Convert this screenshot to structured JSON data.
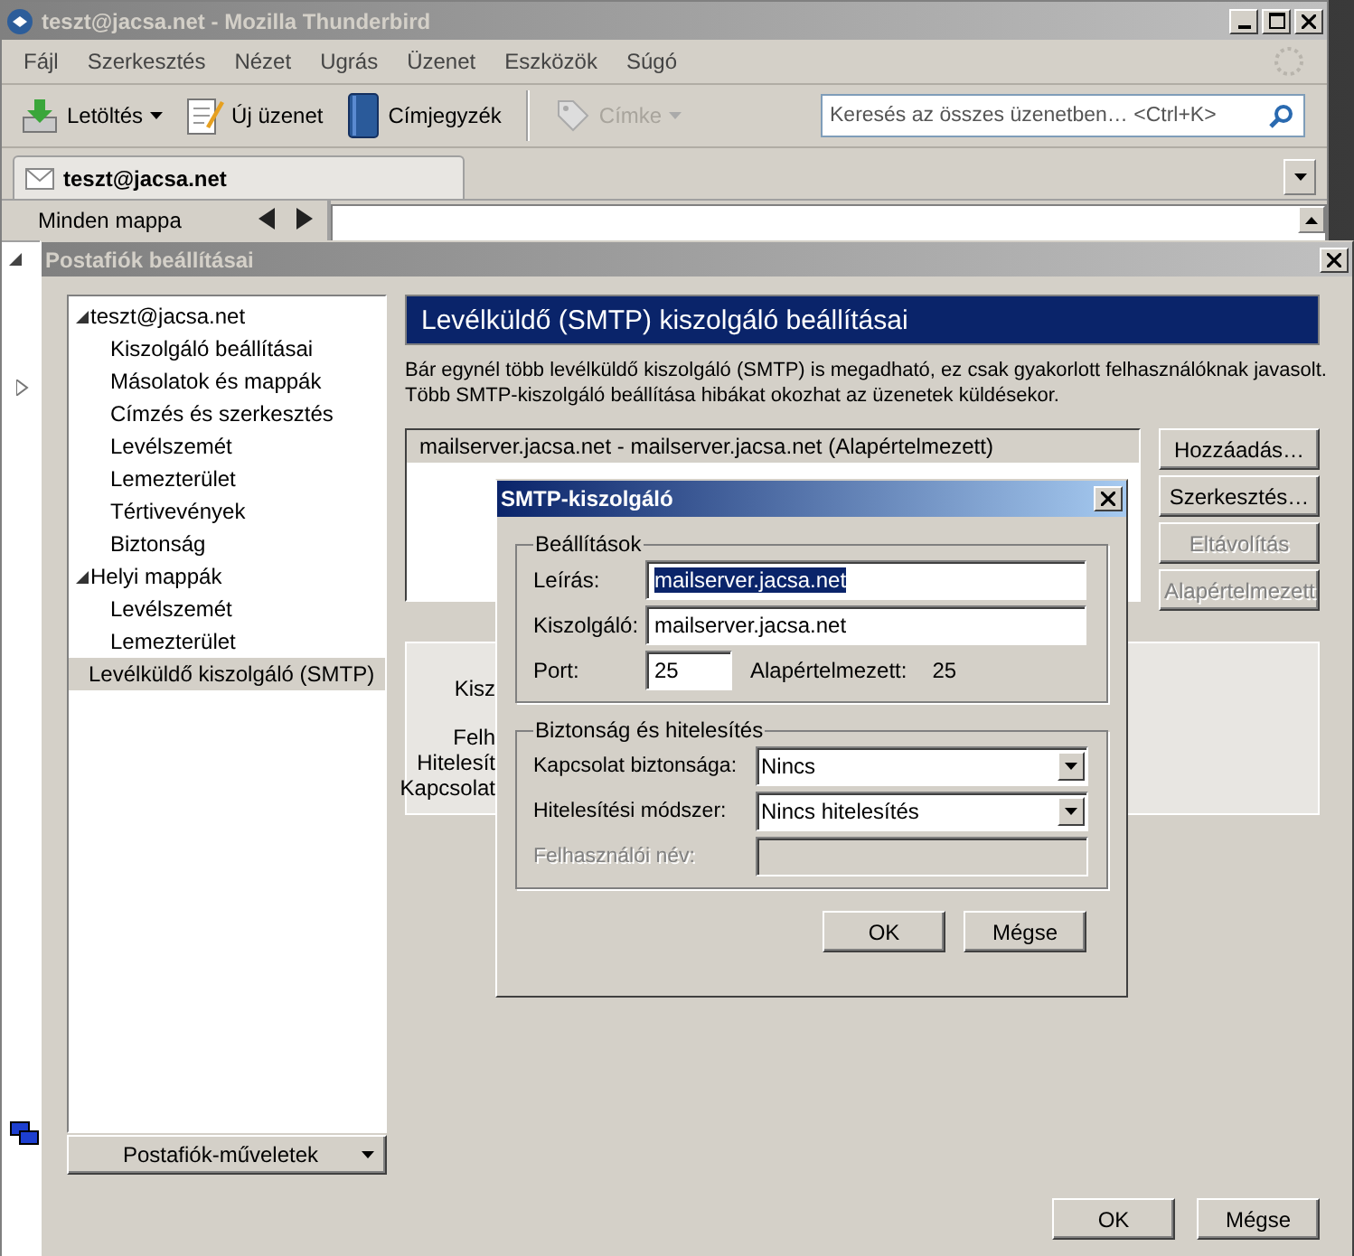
{
  "window": {
    "title": "teszt@jacsa.net - Mozilla Thunderbird"
  },
  "menu": [
    "Fájl",
    "Szerkesztés",
    "Nézet",
    "Ugrás",
    "Üzenet",
    "Eszközök",
    "Súgó"
  ],
  "toolbar": [
    {
      "label": "Letöltés",
      "kind": "download",
      "disabled": false,
      "has_menu": true
    },
    {
      "label": "Új üzenet",
      "kind": "write",
      "disabled": false,
      "has_menu": false
    },
    {
      "label": "Címjegyzék",
      "kind": "book",
      "disabled": false,
      "has_menu": false
    },
    {
      "label": "Címke",
      "kind": "tag",
      "disabled": true,
      "has_menu": true
    }
  ],
  "search": {
    "placeholder": "Keresés az összes üzenetben… <Ctrl+K>"
  },
  "tabs": [
    {
      "label": "teszt@jacsa.net",
      "selected": true
    }
  ],
  "folder_pane": {
    "title": "Minden mappa"
  },
  "account_settings": {
    "title": "Postafiók beállításai",
    "tree": [
      {
        "label": "teszt@jacsa.net",
        "expanded": true,
        "selected": false,
        "children": [
          {
            "label": "Kiszolgáló beállításai",
            "selected": false
          },
          {
            "label": "Másolatok és mappák",
            "selected": false
          },
          {
            "label": "Címzés és szerkesztés",
            "selected": false
          },
          {
            "label": "Levélszemét",
            "selected": false
          },
          {
            "label": "Lemezterület",
            "selected": false
          },
          {
            "label": "Tértivevények",
            "selected": false
          },
          {
            "label": "Biztonság",
            "selected": false
          }
        ]
      },
      {
        "label": "Helyi mappák",
        "expanded": true,
        "selected": false,
        "children": [
          {
            "label": "Levélszemét",
            "selected": false
          },
          {
            "label": "Lemezterület",
            "selected": false
          }
        ]
      },
      {
        "label": "Levélküldő kiszolgáló (SMTP)",
        "selected": true
      }
    ],
    "actions_button": "Postafiók-műveletek",
    "heading": "Levélküldő (SMTP) kiszolgáló beállításai",
    "description_lines": [
      "Bár egynél több levélküldő kiszolgáló (SMTP) is megadható, ez csak gyakorlott felhasználóknak javasolt.",
      "Több SMTP-kiszolgáló beállítása hibákat okozhat az üzenetek küldésekor."
    ],
    "servers": [
      {
        "label": "mailserver.jacsa.net - mailserver.jacsa.net (Alapértelmezett)",
        "selected": true
      }
    ],
    "side_buttons": [
      {
        "label": "Hozzáadás…",
        "disabled": false
      },
      {
        "label": "Szerkesztés…",
        "disabled": false
      },
      {
        "label": "Eltávolítás",
        "disabled": true
      },
      {
        "label": "Alapértelmezett",
        "disabled": true
      }
    ],
    "detail_labels": [
      "Kisz",
      "Felh",
      "Hitelesít",
      "Kapcsolat"
    ],
    "buttons": [
      "OK",
      "Mégse"
    ]
  },
  "smtp_dialog": {
    "title": "SMTP-kiszolgáló",
    "settings": {
      "legend": "Beállítások",
      "description": {
        "label": "Leírás:",
        "value": "mailserver.jacsa.net",
        "text_selected": true
      },
      "server": {
        "label": "Kiszolgáló:",
        "value": "mailserver.jacsa.net"
      },
      "port": {
        "label": "Port:",
        "value": "25",
        "default_label": "Alapértelmezett:",
        "default_value": "25"
      }
    },
    "security": {
      "legend": "Biztonság és hitelesítés",
      "fields": [
        {
          "label": "Kapcsolat biztonsága:",
          "kind": "dropdown",
          "value": "Nincs",
          "disabled": false
        },
        {
          "label": "Hitelesítési módszer:",
          "kind": "dropdown",
          "value": "Nincs hitelesítés",
          "disabled": false
        },
        {
          "label": "Felhasználói név:",
          "kind": "text",
          "disabled": true
        }
      ]
    },
    "buttons": [
      "OK",
      "Mégse"
    ]
  }
}
